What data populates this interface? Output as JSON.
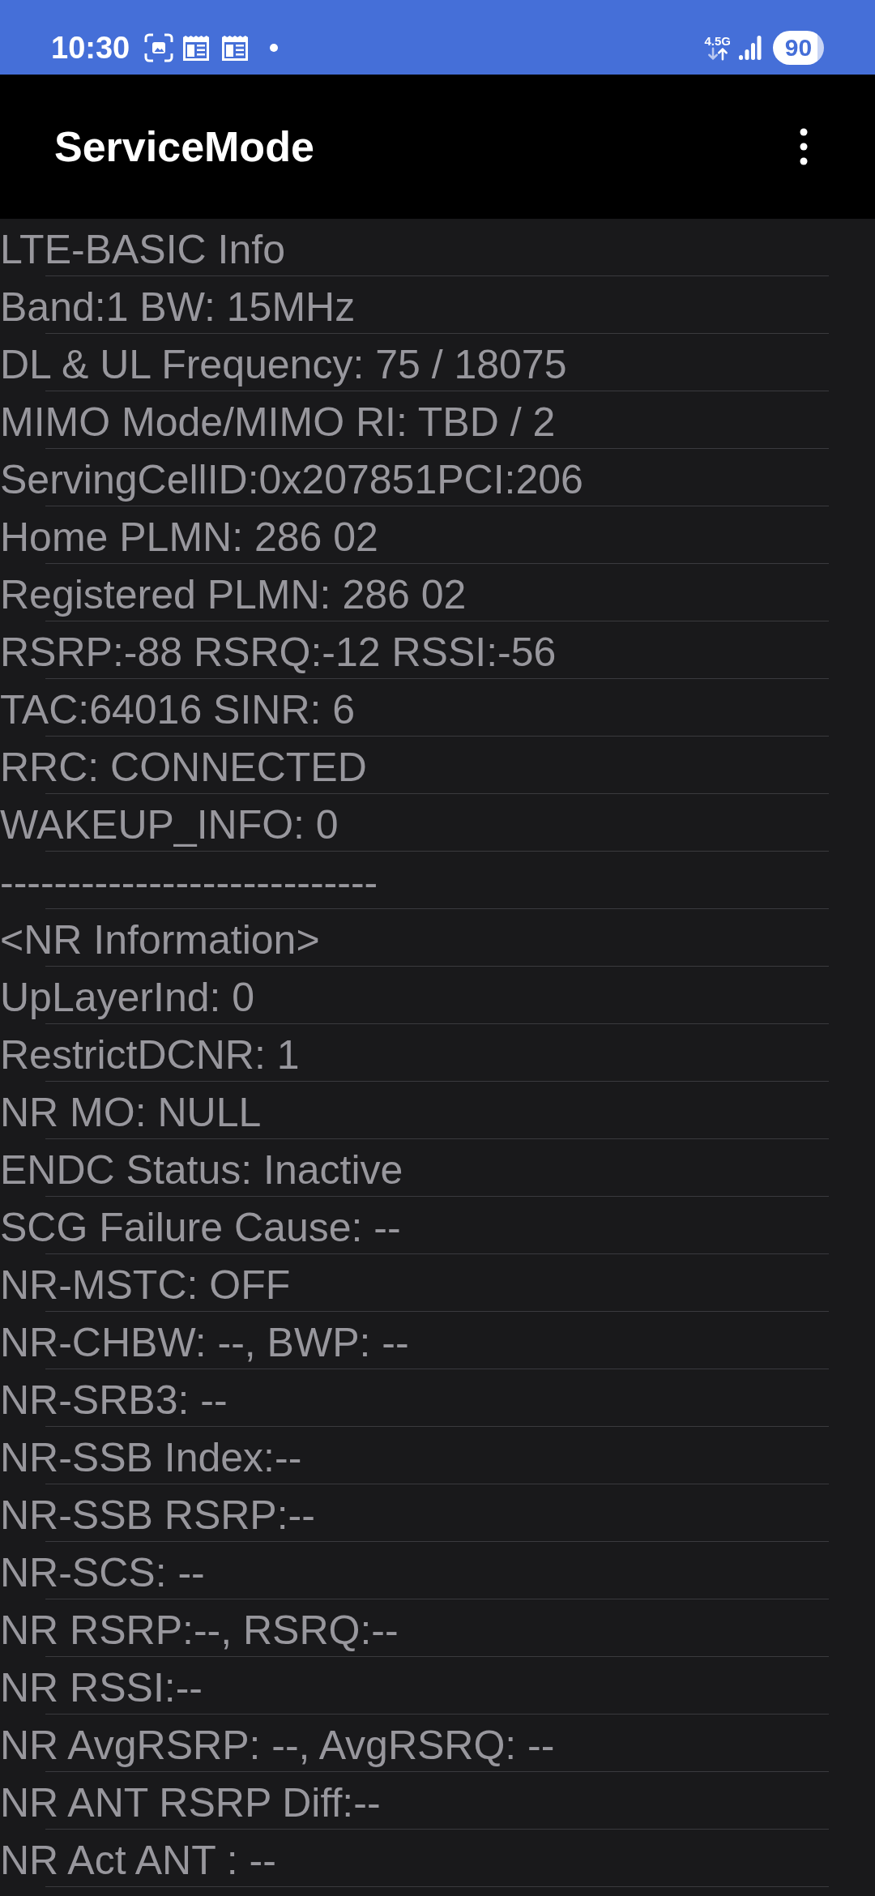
{
  "status_bar": {
    "time": "10:30",
    "network_type": "4.5G",
    "battery": "90"
  },
  "app_bar": {
    "title": "ServiceMode"
  },
  "info_lines": [
    "LTE-BASIC Info",
    "Band:1 BW: 15MHz",
    "DL & UL Frequency: 75 / 18075",
    "MIMO Mode/MIMO RI: TBD / 2",
    "ServingCellID:0x207851PCI:206",
    "Home PLMN: 286 02",
    "Registered PLMN: 286 02",
    "RSRP:-88 RSRQ:-12 RSSI:-56",
    "TAC:64016 SINR: 6",
    "RRC: CONNECTED",
    "WAKEUP_INFO: 0",
    "----------------------------",
    "<NR Information>",
    "UpLayerInd: 0",
    "RestrictDCNR: 1",
    "NR MO: NULL",
    "ENDC Status: Inactive",
    "SCG Failure Cause: --",
    "NR-MSTC: OFF",
    "NR-CHBW: --, BWP: --",
    "NR-SRB3: --",
    "NR-SSB Index:--",
    "NR-SSB RSRP:--",
    "NR-SCS: --",
    "NR RSRP:--, RSRQ:--",
    "NR RSSI:--",
    "NR AvgRSRP: --, AvgRSRQ: --",
    "NR ANT RSRP Diff:--",
    "NR Act ANT : --"
  ]
}
